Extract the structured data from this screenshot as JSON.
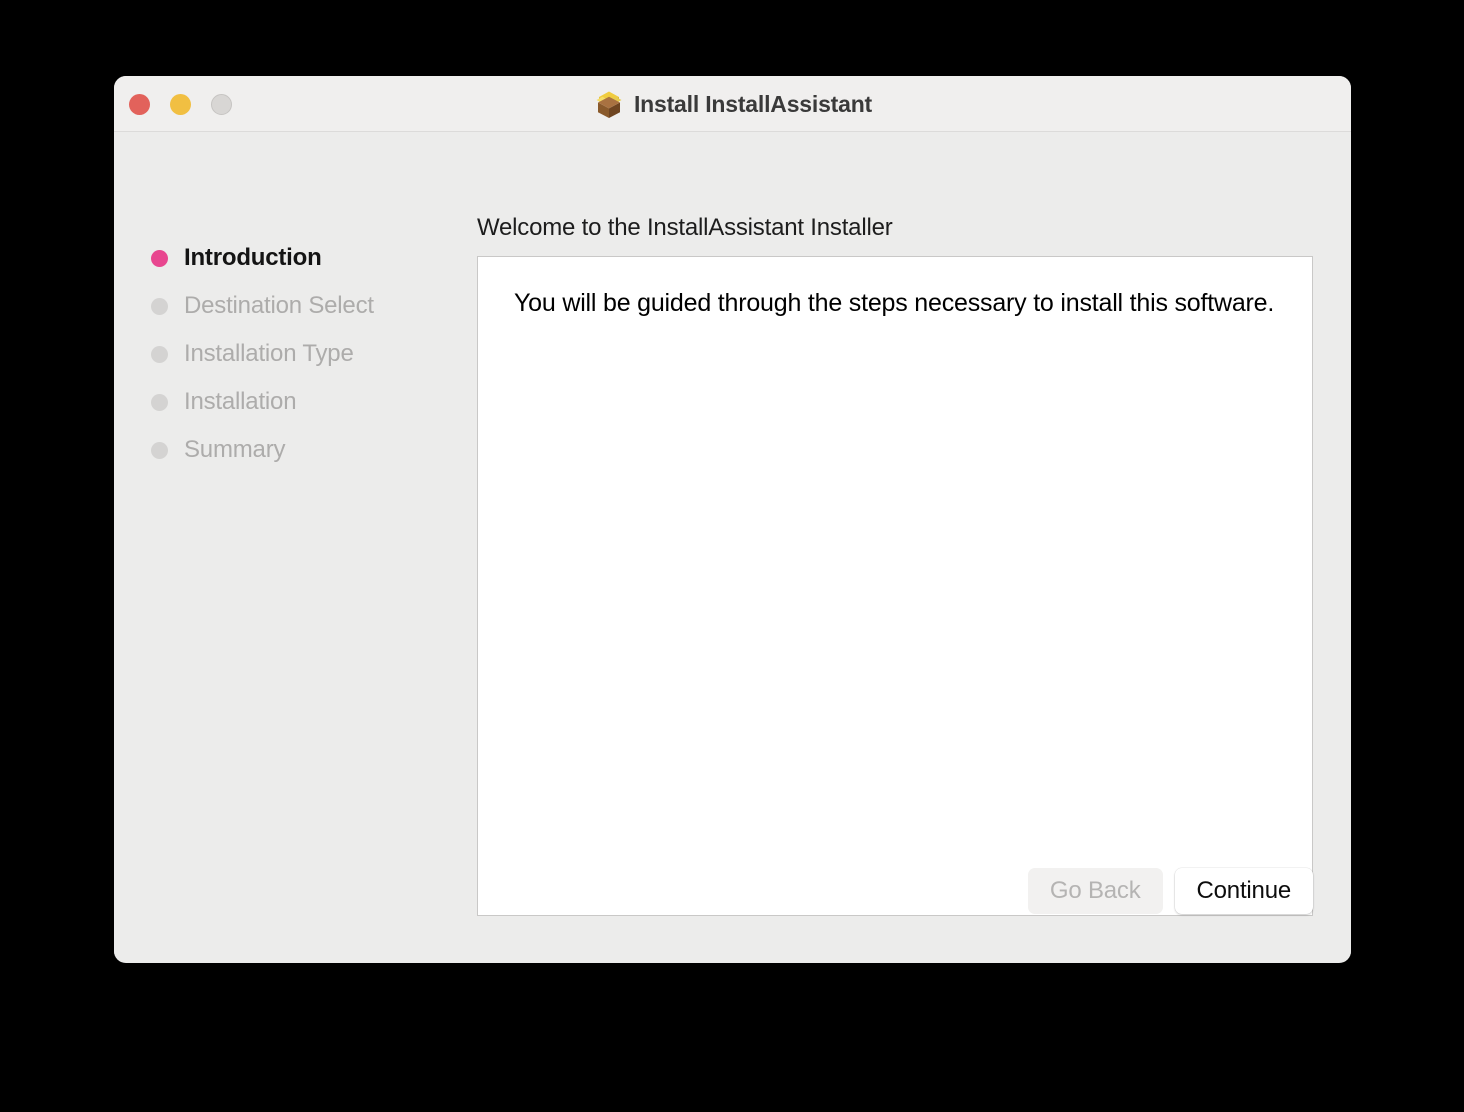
{
  "window": {
    "title": "Install InstallAssistant",
    "icon": "package-box-icon",
    "traffic_lights": {
      "close_label": "Close",
      "minimize_label": "Minimize",
      "zoom_label": "Zoom",
      "close_color": "#e2625b",
      "minimize_color": "#f1bf42",
      "zoom_color": "#d8d6d4"
    },
    "background_color": "#ececeb",
    "titlebar_color": "#f0efee"
  },
  "sidebar": {
    "active_dot_color": "#e8468f",
    "inactive_dot_color": "#d4d3d2",
    "steps": [
      {
        "label": "Introduction",
        "state": "active"
      },
      {
        "label": "Destination Select",
        "state": "pending"
      },
      {
        "label": "Installation Type",
        "state": "pending"
      },
      {
        "label": "Installation",
        "state": "pending"
      },
      {
        "label": "Summary",
        "state": "pending"
      }
    ]
  },
  "main": {
    "heading": "Welcome to the InstallAssistant Installer",
    "body": "You will be guided through the steps necessary to install this software."
  },
  "footer": {
    "go_back_label": "Go Back",
    "continue_label": "Continue"
  }
}
